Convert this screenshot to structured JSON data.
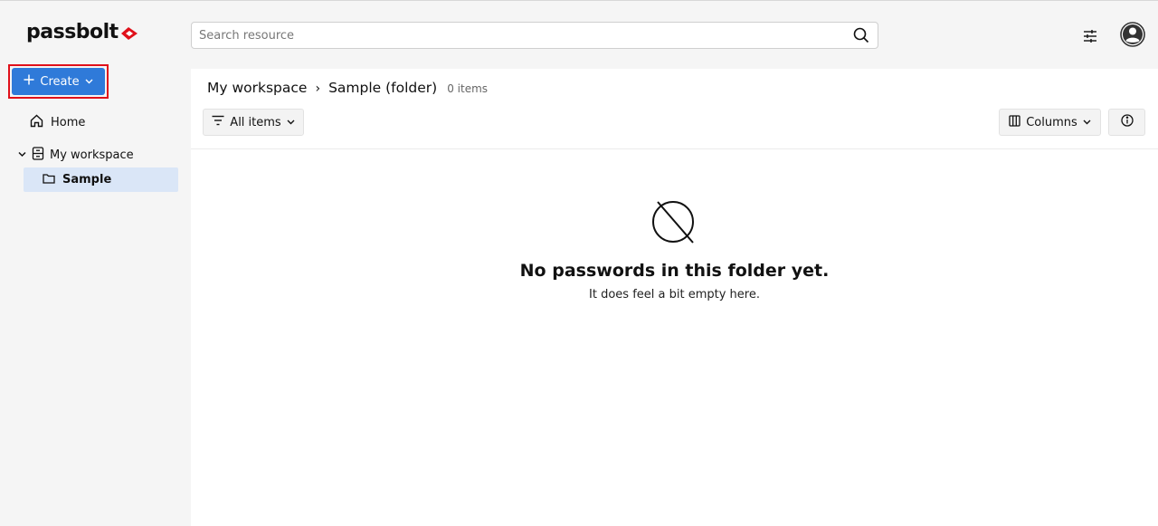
{
  "app": {
    "logo_text": "passbolt",
    "brand_color": "#e0101a",
    "accent_color": "#2f7ad9"
  },
  "header": {
    "search_placeholder": "Search resource",
    "search_icon": "search-icon",
    "filter_icon": "sliders-icon",
    "avatar_icon": "user-avatar-icon"
  },
  "sidebar": {
    "create_label": "Create",
    "items": [
      {
        "label": "Home",
        "icon": "home-icon"
      },
      {
        "label": "My workspace",
        "icon": "workspace-icon",
        "expanded": true
      },
      {
        "label": "Sample",
        "icon": "folder-icon",
        "selected": true
      }
    ]
  },
  "main": {
    "breadcrumb": {
      "root": "My workspace",
      "separator": "›",
      "current": "Sample (folder)",
      "count": "0 items"
    },
    "filter_label": "All items",
    "columns_label": "Columns",
    "empty_state": {
      "title": "No passwords in this folder yet.",
      "subtitle": "It does feel a bit empty here."
    }
  }
}
